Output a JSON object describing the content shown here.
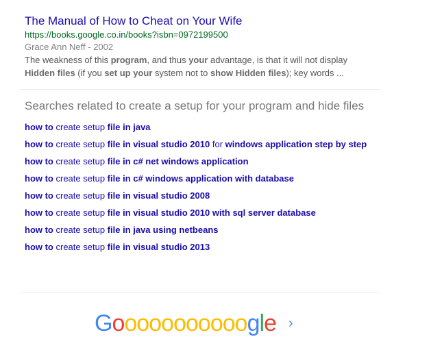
{
  "result": {
    "title": "The Manual of How to Cheat on Your Wife",
    "url": "https://books.google.co.in/books?isbn=0972199500",
    "meta": "Grace Ann Neff - 2002",
    "snippet_line1": [
      {
        "t": "The weakness of this ",
        "b": false
      },
      {
        "t": "program",
        "b": true
      },
      {
        "t": ", and thus ",
        "b": false
      },
      {
        "t": "your",
        "b": true
      },
      {
        "t": " advantage, is that it will not display",
        "b": false
      }
    ],
    "snippet_line2": [
      {
        "t": "Hidden files",
        "b": true
      },
      {
        "t": " (if you ",
        "b": false
      },
      {
        "t": "set up your",
        "b": true
      },
      {
        "t": " system not to ",
        "b": false
      },
      {
        "t": "show Hidden files",
        "b": true
      },
      {
        "t": "); key words  ...",
        "b": false
      }
    ]
  },
  "related": {
    "heading": "Searches related to create a setup for your program and hide files",
    "items": [
      [
        {
          "t": "how to",
          "b": true
        },
        {
          "t": " create setup ",
          "b": false
        },
        {
          "t": "file in java",
          "b": true
        }
      ],
      [
        {
          "t": "how to",
          "b": true
        },
        {
          "t": " create setup ",
          "b": false
        },
        {
          "t": "file in visual studio 2010",
          "b": true
        },
        {
          "t": " for ",
          "b": false
        },
        {
          "t": "windows application step by step",
          "b": true
        }
      ],
      [
        {
          "t": "how to",
          "b": true
        },
        {
          "t": " create setup ",
          "b": false
        },
        {
          "t": "file in c# net windows application",
          "b": true
        }
      ],
      [
        {
          "t": "how to",
          "b": true
        },
        {
          "t": " create setup ",
          "b": false
        },
        {
          "t": "file in c# windows application with database",
          "b": true
        }
      ],
      [
        {
          "t": "how to",
          "b": true
        },
        {
          "t": " create setup ",
          "b": false
        },
        {
          "t": "file in visual studio 2008",
          "b": true
        }
      ],
      [
        {
          "t": "how to",
          "b": true
        },
        {
          "t": " create setup ",
          "b": false
        },
        {
          "t": "file in visual studio 2010 with sql server database",
          "b": true
        }
      ],
      [
        {
          "t": "how to",
          "b": true
        },
        {
          "t": " create setup ",
          "b": false
        },
        {
          "t": "file in java using netbeans",
          "b": true
        }
      ],
      [
        {
          "t": "how to",
          "b": true
        },
        {
          "t": " create setup ",
          "b": false
        },
        {
          "t": "file in visual studio 2013",
          "b": true
        }
      ]
    ]
  },
  "pager": {
    "logo_g": "G",
    "logo_os": "ooooooooooo",
    "logo_g2": "g",
    "logo_l": "l",
    "logo_e": "e",
    "next_icon": "chevron-right-icon",
    "next_glyph": "›"
  },
  "colors": {
    "link": "#1a0dab",
    "url": "#006621",
    "snippet": "#545454",
    "heading": "#777777"
  }
}
